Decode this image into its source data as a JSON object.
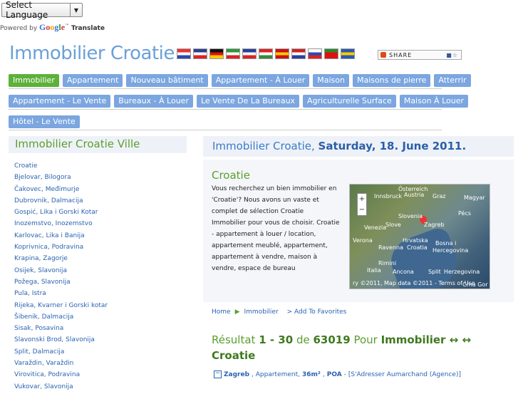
{
  "translate": {
    "select_label": "Select Language",
    "powered_by": "Powered by",
    "google": "Google",
    "translate": "Translate"
  },
  "site_title": "Immobilier Croatie",
  "flags": [
    {
      "country": "hr",
      "colors": [
        "#e33",
        "#fff",
        "#2a4ab0"
      ]
    },
    {
      "country": "gb",
      "colors": [
        "#2a3f8f",
        "#fff",
        "#d22"
      ]
    },
    {
      "country": "de",
      "colors": [
        "#111",
        "#d11",
        "#fc0"
      ]
    },
    {
      "country": "it",
      "colors": [
        "#2a9a3a",
        "#fff",
        "#d22"
      ]
    },
    {
      "country": "fr",
      "colors": [
        "#2a3f9f",
        "#fff",
        "#d22"
      ]
    },
    {
      "country": "hu",
      "colors": [
        "#d22",
        "#fff",
        "#3a8a3a"
      ]
    },
    {
      "country": "es",
      "colors": [
        "#c11",
        "#fc0",
        "#c11"
      ]
    },
    {
      "country": "nl",
      "colors": [
        "#c22",
        "#fff",
        "#2a3f9f"
      ]
    },
    {
      "country": "si",
      "colors": [
        "#fff",
        "#2a4ab0",
        "#d22"
      ]
    },
    {
      "country": "pt",
      "colors": [
        "#2a8a2a",
        "#d11",
        "#d11"
      ]
    },
    {
      "country": "se",
      "colors": [
        "#2a5aa8",
        "#fc0",
        "#2a5aa8"
      ]
    }
  ],
  "share": {
    "label": "SHARE",
    "more": "■☆"
  },
  "nav_rows": [
    [
      {
        "label": "Immobilier",
        "active": true
      },
      {
        "label": "Appartement"
      },
      {
        "label": "Nouveau bâtiment"
      },
      {
        "label": "Appartement - À Louer"
      },
      {
        "label": "Maison"
      },
      {
        "label": "Maisons de pierre"
      },
      {
        "label": "Atterrir"
      }
    ],
    [
      {
        "label": "Appartement - Le Vente"
      },
      {
        "label": "Bureaux - À Louer"
      },
      {
        "label": "Le Vente De La Bureaux"
      },
      {
        "label": "Agriculturelle Surface"
      },
      {
        "label": "Maison À Louer"
      }
    ],
    [
      {
        "label": "Hôtel - Le Vente"
      }
    ]
  ],
  "sidebar": {
    "heading": "Immobilier Croatie Ville",
    "cities": [
      "Croatie",
      "Bjelovar, Bilogora",
      "Čakovec, Međimurje",
      "Dubrovnik, Dalmacija",
      "Gospić, Lika i Gorski Kotar",
      "Inozemstvo, Inozemstvo",
      "Karlovac, Lika i Banija",
      "Koprivnica, Podravina",
      "Krapina, Zagorje",
      "Osijek, Slavonija",
      "Požega, Slavonija",
      "Pula, Istra",
      "Rijeka, Kvarner i Gorski kotar",
      "Šibenik, Dalmacija",
      "Sisak, Posavina",
      "Slavonski Brod, Slavonija",
      "Split, Dalmacija",
      "Varaždin, Varaždin",
      "Virovitica, Podravina",
      "Vukovar, Slavonija"
    ]
  },
  "main": {
    "heading_prefix": "Immobilier Croatie, ",
    "heading_date": "Saturday, 18. June 2011.",
    "section_title": "Croatie",
    "description": "Vous recherchez un bien immobilier en 'Croatie'? Nous avons un vaste et complet de sélection Croatie Immobilier pour vous de choisir. Croatie - appartement à louer / location, appartement meublé, appartement, appartement à vendre, maison à vendre, espace de bureau",
    "map": {
      "labels": [
        "Österreich",
        "Austria",
        "Innsbruck",
        "Graz",
        "Magyar",
        "Pécs",
        "Slovenia",
        "Slove",
        "Zagreb",
        "Venezia",
        "Verona",
        "Hrvatska",
        "Ravenna",
        "Croatia",
        "Bosna i",
        "Hercegovina",
        "Rimini",
        "Italia",
        "Ancona",
        "Split",
        "Herzegovina",
        "Crna Gor"
      ],
      "copyright": "ry ©2011, Map data ©2011 - Terms of Use",
      "zoom_in": "+",
      "zoom_out": "−"
    },
    "breadcrumb": {
      "home": "Home",
      "current": "Immobilier",
      "favorites": "> Add To Favorites"
    },
    "result": {
      "prefix": "Résultat ",
      "range": "1 - 30",
      "of": " de ",
      "total": "63019",
      "for": " Pour ",
      "term": "Immobilier ↔ ↔ Croatie"
    },
    "listing": {
      "city": "Zagreb",
      "type": ", Appartement, ",
      "area": "36m²",
      "sep": ", ",
      "price": "POA",
      "agency": " - [S'Adresser Aumarchand (Agence)]"
    }
  }
}
